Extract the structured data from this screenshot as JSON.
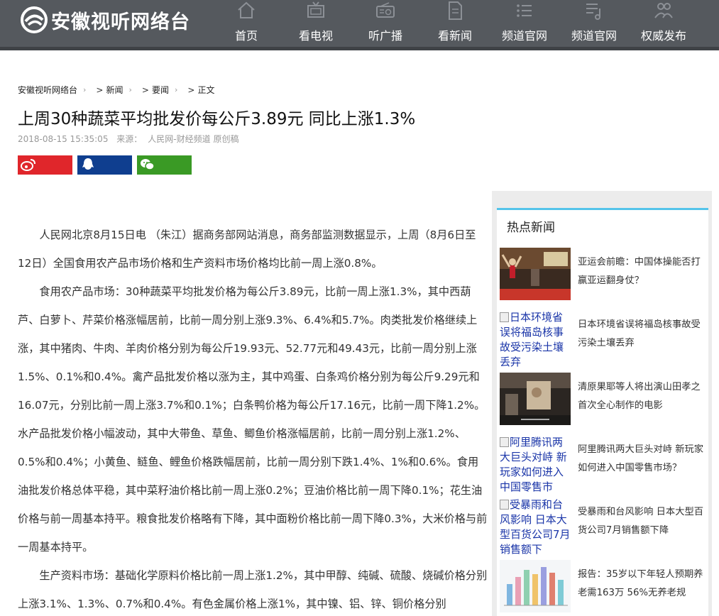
{
  "header": {
    "logo_text": "安徽视听网络台",
    "nav": [
      {
        "label": "首页",
        "icon": "home-icon"
      },
      {
        "label": "看电视",
        "icon": "tv-icon"
      },
      {
        "label": "听广播",
        "icon": "radio-icon"
      },
      {
        "label": "看新闻",
        "icon": "document-icon"
      },
      {
        "label": "频道官网",
        "icon": "list-icon"
      },
      {
        "label": "频道官网",
        "icon": "music-list-icon"
      },
      {
        "label": "权威发布",
        "icon": "people-icon"
      }
    ]
  },
  "breadcrumb": {
    "home": "安徽视听网络台",
    "news": "新闻",
    "important": "要闻",
    "current": "正文",
    "sep": "›",
    "arrow": ">"
  },
  "article": {
    "title": "上周30种蔬菜平均批发价每公斤3.89元 同比上涨1.3%",
    "datetime": "2018-08-15 15:35:05",
    "source_label": "来源：",
    "source": "人民网-财经频道 原创稿",
    "paragraphs": [
      "人民网北京8月15日电 （朱江）据商务部网站消息，商务部监测数据显示，上周（8月6日至12日）全国食用农产品市场价格和生产资料市场价格均比前一周上涨0.8%。",
      "食用农产品市场：30种蔬菜平均批发价格为每公斤3.89元，比前一周上涨1.3%，其中西葫芦、白萝卜、芹菜价格涨幅居前，比前一周分别上涨9.3%、6.4%和5.7%。肉类批发价格继续上涨，其中猪肉、牛肉、羊肉价格分别为每公斤19.93元、52.77元和49.43元，比前一周分别上涨1.5%、0.1%和0.4%。禽产品批发价格以涨为主，其中鸡蛋、白条鸡价格分别为每公斤9.29元和16.07元，分别比前一周上涨3.7%和0.1%；白条鸭价格为每公斤17.16元，比前一周下降1.2%。水产品批发价格小幅波动，其中大带鱼、草鱼、鲫鱼价格涨幅居前，比前一周分别上涨1.2%、0.5%和0.4%；小黄鱼、鲢鱼、鲤鱼价格跌幅居前，比前一周分别下跌1.4%、1%和0.6%。食用油批发价格总体平稳，其中菜籽油价格比前一周上涨0.2%；豆油价格比前一周下降0.1%；花生油价格与前一周基本持平。粮食批发价格略有下降，其中面粉价格比前一周下降0.3%，大米价格与前一周基本持平。",
      "生产资料市场：基础化学原料价格比前一周上涨1.2%，其中甲醇、纯碱、硫酸、烧碱价格分别上涨3.1%、1.3%、0.7%和0.4%。有色金属价格上涨1%，其中镍、铝、锌、铜价格分别"
    ]
  },
  "share": [
    {
      "name": "weibo",
      "color": "#e0262b",
      "icon": "weibo-icon"
    },
    {
      "name": "qq",
      "color": "#0f3e8f",
      "icon": "qq-icon"
    },
    {
      "name": "wechat",
      "color": "#3a9a25",
      "icon": "wechat-icon"
    }
  ],
  "sidebar": {
    "title": "热点新闻",
    "items": [
      {
        "text": "亚运会前瞻：中国体操能否打赢亚运翻身仗？",
        "thumb": "gymnast-photo",
        "alt": ""
      },
      {
        "text": "日本环境省误将福岛核事故受污染土壤丢弃",
        "thumb": "",
        "alt": "日本环境省误将福岛核事故受污染土壤丢弃"
      },
      {
        "text": "清原果耶等人将出演山田孝之首次全心制作的电影",
        "thumb": "film-still-photo",
        "alt": ""
      },
      {
        "text": "阿里腾讯两大巨头对峙 新玩家如何进入中国零售市场？",
        "thumb": "",
        "alt": "阿里腾讯两大巨头对峙 新玩家如何进入中国零售市"
      },
      {
        "text": "受暴雨和台风影响 日本大型百货公司7月销售额下降",
        "thumb": "",
        "alt": "受暴雨和台风影响 日本大型百货公司7月销售额下"
      },
      {
        "text": "报告：35岁以下年轻人预期养老需163万 56%无养老规",
        "thumb": "bar-chart-photo",
        "alt": ""
      }
    ]
  },
  "colors": {
    "header": "#55595e",
    "accent": "#54c4ea",
    "link_alt": "#1a35a8"
  }
}
